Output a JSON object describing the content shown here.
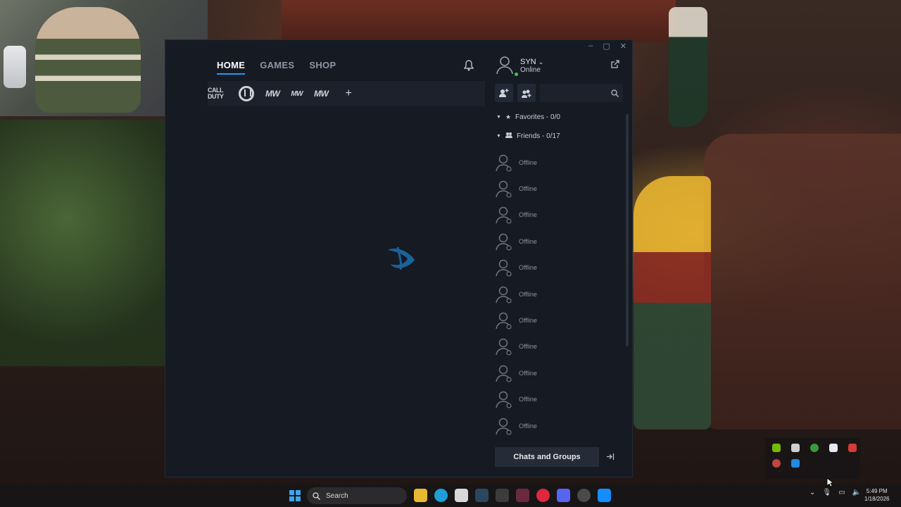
{
  "webcam": {
    "label": ""
  },
  "window": {
    "controls": [
      "–",
      "▢",
      "✕"
    ],
    "nav": {
      "home": "HOME",
      "games": "GAMES",
      "shop": "SHOP"
    },
    "games_bar": {
      "cod_line1": "CALL",
      "cod_line2": "DUTY",
      "mw": "MW",
      "mw2": "MW",
      "mw3": "MW",
      "add": "+"
    }
  },
  "social": {
    "profile": {
      "name": "SYN",
      "status": "Online",
      "status_color": "#3ec74a"
    },
    "favorites": "Favorites - 0/0",
    "friends_header": "Friends - 0/17",
    "friends": [
      "Offline",
      "Offline",
      "Offline",
      "Offline",
      "Offline",
      "Offline",
      "Offline",
      "Offline",
      "Offline",
      "Offline",
      "Offline"
    ],
    "chats_button": "Chats and Groups"
  },
  "taskbar": {
    "search_placeholder": "Search",
    "time": "5:49 PM",
    "date": "1/18/2026"
  },
  "colors": {
    "accent": "#1f9cf0",
    "window_bg": "#151a23"
  }
}
